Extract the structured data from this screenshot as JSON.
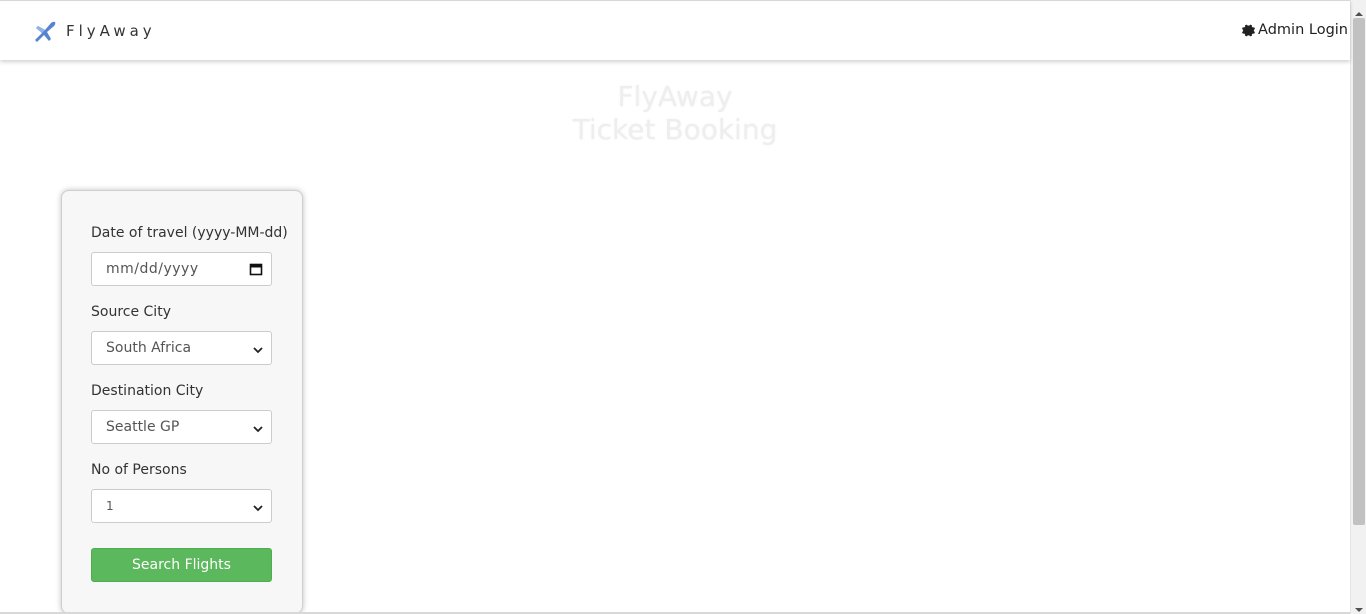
{
  "navbar": {
    "brand_name": "FlyAway",
    "brand_icon": "airplane-icon",
    "admin_label": "Admin Login",
    "admin_icon": "gear-icon"
  },
  "hero": {
    "line1": "FlyAway",
    "line2": "Ticket Booking"
  },
  "form": {
    "date_label": "Date of travel (yyyy-MM-dd)",
    "date_placeholder": "mm/dd/yyyy",
    "source_label": "Source City",
    "source_value": "South Africa",
    "destination_label": "Destination City",
    "destination_value": "Seattle GP",
    "persons_label": "No of Persons",
    "persons_value": "1",
    "search_button": "Search Flights"
  },
  "colors": {
    "button_green": "#5cb85c",
    "hero_text": "#eeeeee"
  }
}
